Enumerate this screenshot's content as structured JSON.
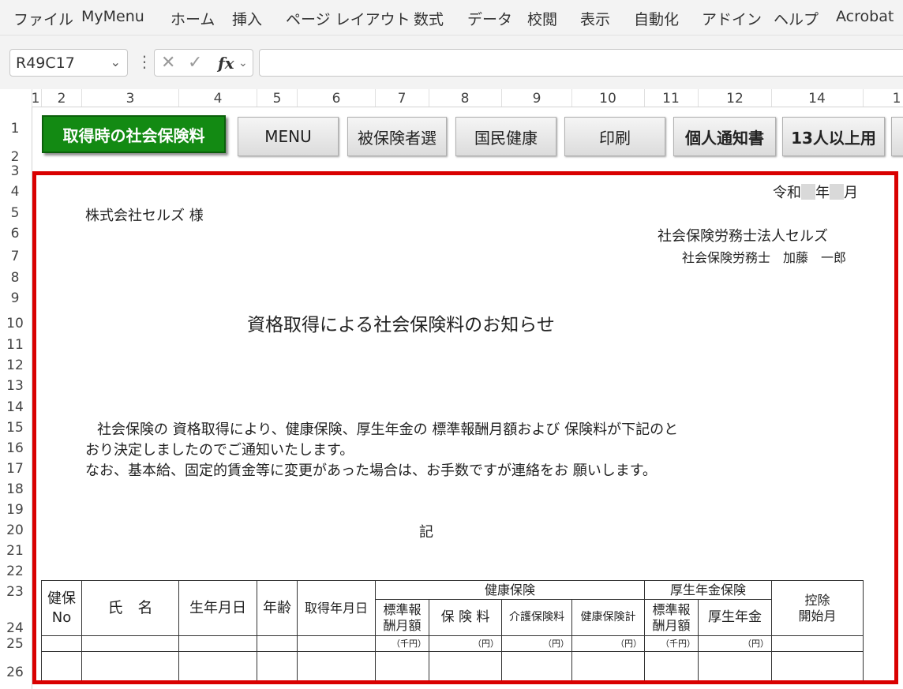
{
  "menu": [
    "ファイル",
    "MyMenu",
    "ホーム",
    "挿入",
    "ページ レイアウト",
    "数式",
    "データ",
    "校閲",
    "表示",
    "自動化",
    "アドイン",
    "ヘルプ",
    "Acrobat"
  ],
  "formula_bar": {
    "name_box": "R49C17",
    "fx_label": "fx",
    "formula": ""
  },
  "column_headers": [
    "1",
    "2",
    "3",
    "4",
    "5",
    "6",
    "7",
    "8",
    "9",
    "10",
    "11",
    "12",
    "14",
    "1"
  ],
  "row_headers": [
    "1",
    "2",
    "3",
    "4",
    "5",
    "6",
    "7",
    "8",
    "9",
    "10",
    "11",
    "12",
    "13",
    "14",
    "15",
    "16",
    "17",
    "18",
    "19",
    "20",
    "21",
    "22",
    "23",
    "24",
    "25",
    "26"
  ],
  "buttons": {
    "acquisition": "取得時の社会保険料",
    "menu": "MENU",
    "insured_select": "被保険者選",
    "national_health": "国民健康",
    "print": "印刷",
    "personal_notice": "個人通知書",
    "over13": "13人以上用"
  },
  "letter": {
    "date_prefix": "令和",
    "date_year_suffix": "年",
    "date_month_suffix": "月",
    "recipient": "株式会社セルズ 様",
    "sender_org": "社会保険労務士法人セルズ",
    "sender_person": "社会保険労務士　加藤　一郎",
    "title": "資格取得による社会保険料のお知らせ",
    "body_line1": "社会保険の 資格取得により、健康保険、厚生年金の 標準報酬月額および 保険料が下記のと",
    "body_line2": "おり決定しましたのでご通知いたします。",
    "body_line3": "なお、基本給、固定的賃金等に変更があった場合は、お手数ですが連絡をお 願いします。",
    "ki": "記"
  },
  "table": {
    "col_no_1": "健保",
    "col_no_2": "No",
    "col_name": "氏　名",
    "col_birth": "生年月日",
    "col_age": "年齢",
    "col_acquired": "取得年月日",
    "group_health": "健康保険",
    "group_pension": "厚生年金保険",
    "std_monthly_1": "標準報",
    "std_monthly_2": "酬月額",
    "premium": "保 険 料",
    "care_premium": "介護保険料",
    "health_total": "健康保険計",
    "pension_std_1": "標準報",
    "pension_std_2": "酬月額",
    "pension": "厚生年金",
    "deduction_1": "控除",
    "deduction_2": "開始月",
    "unit_thousand": "（千円）",
    "unit_yen": "（円）"
  }
}
